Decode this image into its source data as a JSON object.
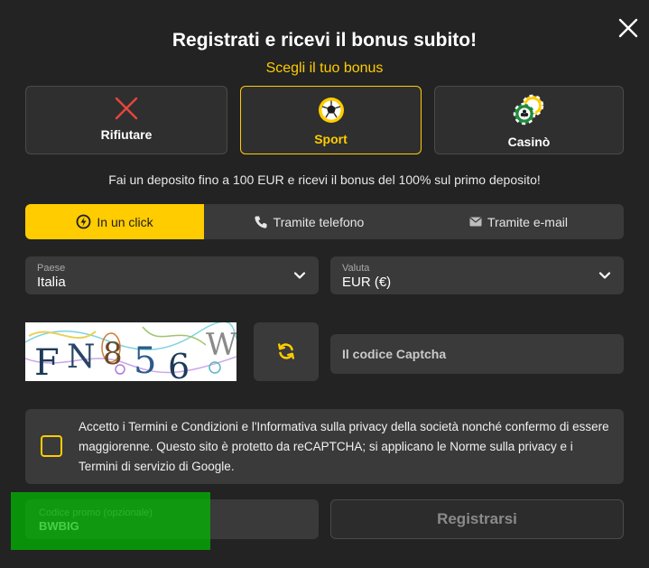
{
  "modal": {
    "title": "Registrati e ricevi il bonus subito!",
    "subtitle": "Scegli il tuo bonus"
  },
  "bonus_options": [
    {
      "label": "Rifiutare",
      "icon": "x-icon",
      "selected": false
    },
    {
      "label": "Sport",
      "icon": "soccer-ball-icon",
      "selected": true
    },
    {
      "label": "Casinò",
      "icon": "casino-chips-icon",
      "selected": false
    }
  ],
  "info_text": "Fai un deposito fino a 100 EUR e ricevi il bonus del 100% sul primo deposito!",
  "tabs": [
    {
      "label": "In un click",
      "icon": "lightning-icon",
      "active": true
    },
    {
      "label": "Tramite telefono",
      "icon": "phone-icon",
      "active": false
    },
    {
      "label": "Tramite e-mail",
      "icon": "envelope-icon",
      "active": false
    }
  ],
  "country_select": {
    "label": "Paese",
    "value": "Italia"
  },
  "currency_select": {
    "label": "Valuta",
    "value": "EUR (€)"
  },
  "captcha": {
    "placeholder": "Il codice Captcha",
    "image_text": "FN8 5 6 W"
  },
  "terms": {
    "text": "Accetto i Termini e Condizioni e l'Informativa sulla privacy della società nonché confermo di essere maggiorenne. Questo sito è protetto da reCAPTCHA; si applicano le Norme sulla privacy e i Termini di servizio di Google.",
    "checked": false
  },
  "promo": {
    "label": "Codice promo (opzionale)",
    "value": "BWBIG"
  },
  "register_label": "Registrarsi",
  "colors": {
    "accent": "#ffcc00",
    "background": "#232323",
    "panel": "#3a3a3a",
    "highlight": "#22aa22"
  }
}
